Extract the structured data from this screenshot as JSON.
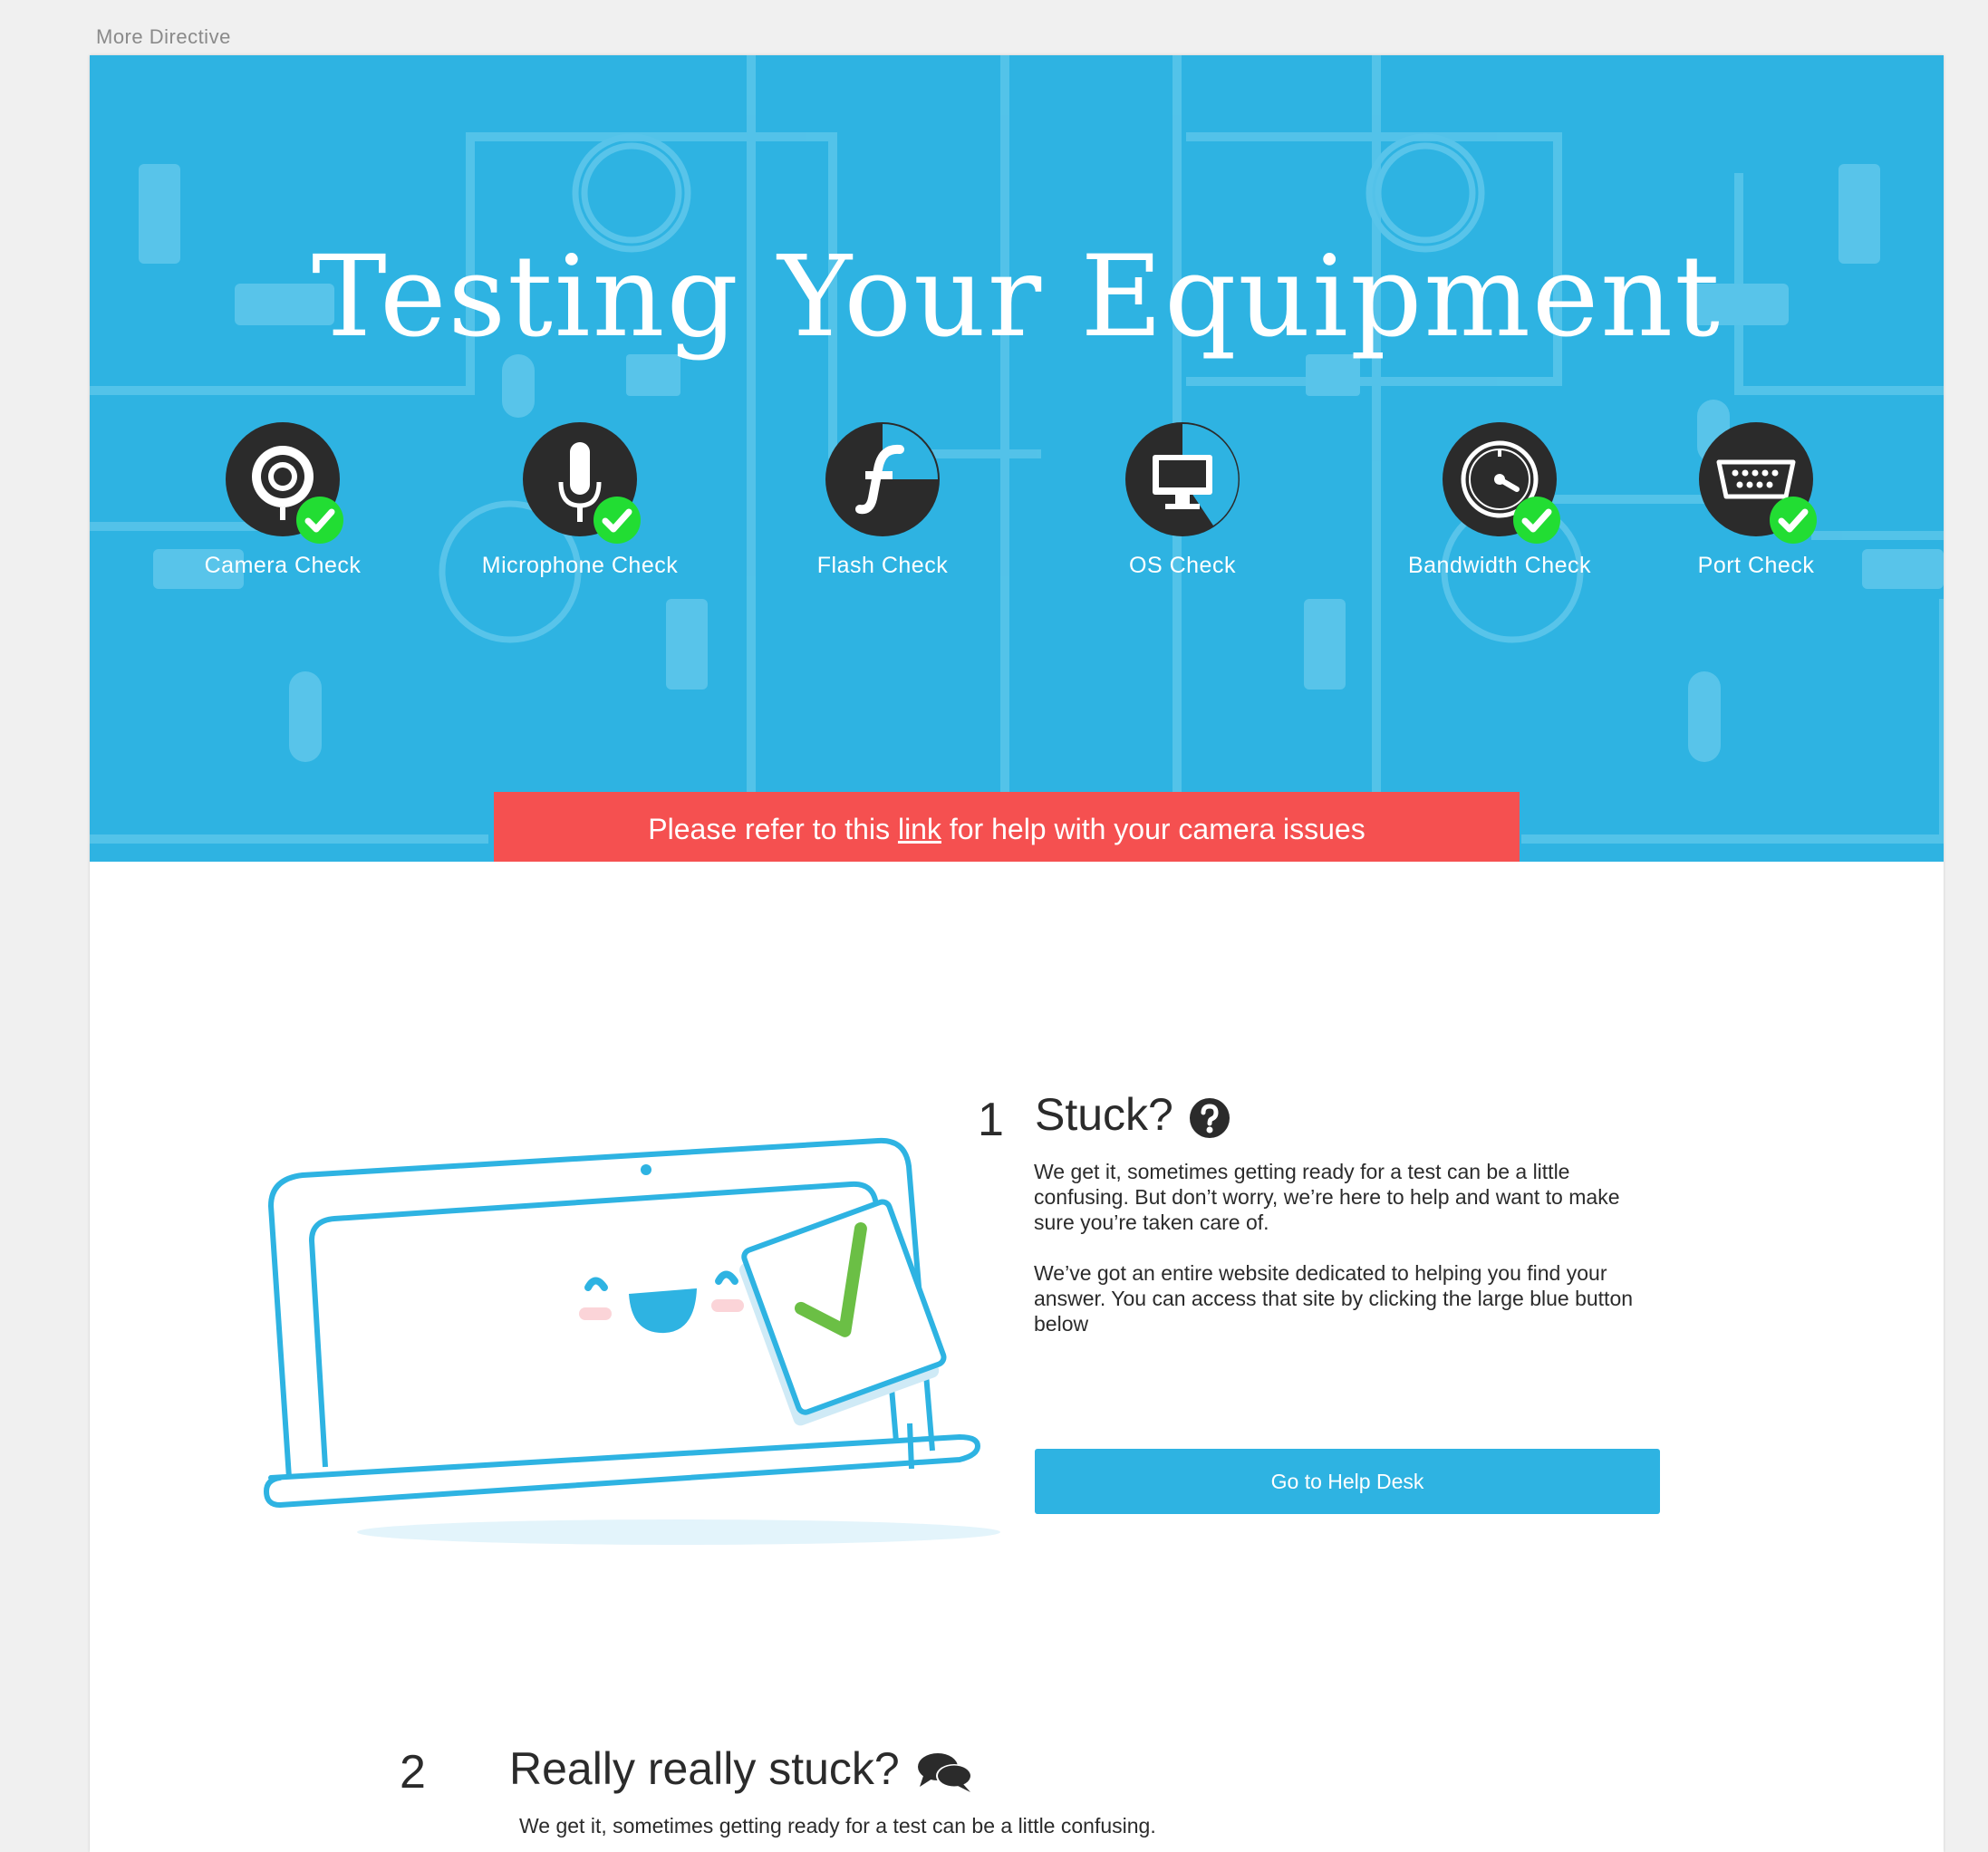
{
  "page_label": "More Directive",
  "hero": {
    "title": "Testing Your Equipment",
    "checks": [
      {
        "label": "Camera Check",
        "icon": "camera-icon",
        "status": "passed"
      },
      {
        "label": "Microphone Check",
        "icon": "microphone-icon",
        "status": "passed"
      },
      {
        "label": "Flash Check",
        "icon": "flash-icon",
        "status": "in-progress"
      },
      {
        "label": "OS Check",
        "icon": "monitor-icon",
        "status": "in-progress"
      },
      {
        "label": "Bandwidth Check",
        "icon": "speedometer-icon",
        "status": "passed"
      },
      {
        "label": "Port Check",
        "icon": "port-icon",
        "status": "passed"
      }
    ]
  },
  "alert": {
    "before": "Please refer to this ",
    "link": "link",
    "after": " for help with your camera issues"
  },
  "step1": {
    "number": "1",
    "title": "Stuck?",
    "paragraph1": "We get it, sometimes getting ready for a test can be a little confusing. But don’t worry, we’re here to help and want to make sure you’re taken care of.",
    "paragraph2": "We’ve got an entire website dedicated to helping you find your answer. You can access that site by clicking the large blue button below",
    "button": "Go to Help Desk"
  },
  "step2": {
    "number": "2",
    "title": "Really really stuck?",
    "paragraph1": "We get it, sometimes getting ready for a test can be a little confusing."
  },
  "colors": {
    "accent": "#2eb3e2",
    "alert": "#f55050",
    "success": "#22dd33",
    "icon_dark": "#2b2b2b",
    "check_green": "#6bbf45"
  }
}
